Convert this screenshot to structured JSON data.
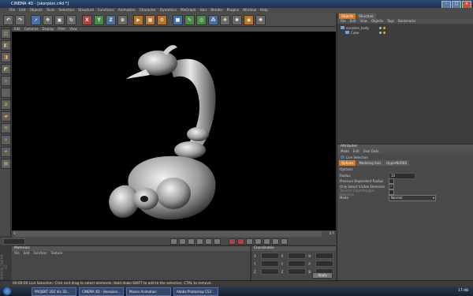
{
  "window": {
    "title": "CINEMA 4D - [skorpion.c4d *]"
  },
  "menu": [
    "File",
    "Edit",
    "Objects",
    "Tools",
    "Selection",
    "Structure",
    "Functions",
    "Animation",
    "Character",
    "Dynamics",
    "MoGraph",
    "Hair",
    "Render",
    "Plugins",
    "Window",
    "Help"
  ],
  "toolbar": {
    "axis_x": "X",
    "axis_y": "Y",
    "axis_z": "Z"
  },
  "viewport": {
    "menu": [
      "Edit",
      "Cameras",
      "Display",
      "Filter",
      "View"
    ]
  },
  "timeline": {
    "start": "0",
    "end": "0 F"
  },
  "materials": {
    "title": "Materials",
    "menu": [
      "File",
      "Edit",
      "Function",
      "Texture"
    ]
  },
  "coordinates": {
    "title": "Coordinates",
    "rows": [
      {
        "a": "X",
        "b": "X",
        "c": "H"
      },
      {
        "a": "Y",
        "b": "Y",
        "c": "P"
      },
      {
        "a": "Z",
        "b": "Z",
        "c": "B"
      }
    ],
    "apply": "Apply"
  },
  "objects_panel": {
    "tabs": [
      "Objects",
      "Structure"
    ],
    "menu": [
      "File",
      "Edit",
      "View",
      "Objects",
      "Tags",
      "Bookmarks"
    ],
    "items": [
      {
        "name": "scorpion_body"
      },
      {
        "name": "Cube"
      }
    ]
  },
  "attributes": {
    "title": "Attributes",
    "menu": [
      "Mode",
      "Edit",
      "User Data"
    ],
    "tool": "Live Selection",
    "tabs": [
      "Options",
      "Modeling Axis",
      "HyperNURBS"
    ],
    "section": "Options",
    "fields": [
      {
        "label": "Radius",
        "value": "10"
      },
      {
        "label": "Pressure Dependent Radius",
        "value": ""
      },
      {
        "label": "Only Select Visible Elements",
        "value": "✓"
      },
      {
        "label": "Tolerant Edge/Polygon Selection",
        "value": ""
      },
      {
        "label": "Mode",
        "value": "Normal"
      }
    ]
  },
  "status": {
    "text": "00:00:00  Live Selection: Click and drag to select elements. Hold down SHIFT to add to the selection, CTRL to remove."
  },
  "taskbar": {
    "tasks": [
      "PROJEKT 3DZ dia 3D...",
      "CINEMA 4D - [skorpion...",
      "Maxon Animation",
      "Adobe Photoshop CS3"
    ],
    "clock": "17:48"
  },
  "side_label": "MAXON CINEMA 4D",
  "colors": {
    "accent": "#d17a2a",
    "viewport_bg": "#000000"
  }
}
